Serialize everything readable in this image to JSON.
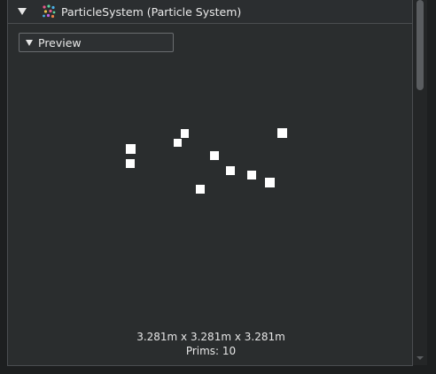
{
  "component_header": {
    "title": "ParticleSystem (Particle System)",
    "icon": "particle-system-icon",
    "expanded": true
  },
  "preview": {
    "label": "Preview",
    "expanded": true,
    "bounds_text": "3.281m x 3.281m x 3.281m",
    "prims_text": "Prims: 10"
  },
  "particles": {
    "count": 10,
    "color": "#ffffff"
  },
  "colors": {
    "panel": "#2a2d2e",
    "header": "#2b2e30",
    "border": "#4a4d50",
    "text": "#e6e6e6"
  }
}
